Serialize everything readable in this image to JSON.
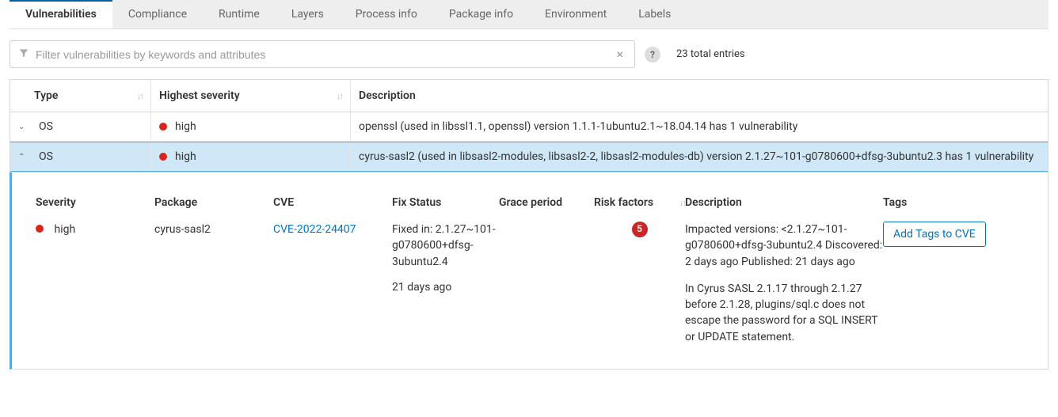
{
  "tabs": [
    {
      "label": "Vulnerabilities",
      "active": true
    },
    {
      "label": "Compliance"
    },
    {
      "label": "Runtime"
    },
    {
      "label": "Layers"
    },
    {
      "label": "Process info"
    },
    {
      "label": "Package info"
    },
    {
      "label": "Environment"
    },
    {
      "label": "Labels"
    }
  ],
  "filter": {
    "placeholder": "Filter vulnerabilities by keywords and attributes"
  },
  "total_entries": "23 total entries",
  "headers": {
    "type": "Type",
    "highest_severity": "Highest severity",
    "description": "Description"
  },
  "rows": [
    {
      "expanded": false,
      "type": "OS",
      "severity": "high",
      "description": "openssl (used in libssl1.1, openssl) version 1.1.1-1ubuntu2.1~18.04.14 has 1 vulnerability"
    },
    {
      "expanded": true,
      "type": "OS",
      "severity": "high",
      "description": "cyrus-sasl2 (used in libsasl2-modules, libsasl2-2, libsasl2-modules-db) version 2.1.27~101-g0780600+dfsg-3ubuntu2.3 has 1 vulnerability"
    }
  ],
  "detail": {
    "headers": {
      "severity": "Severity",
      "package": "Package",
      "cve": "CVE",
      "fix_status": "Fix Status",
      "grace_period": "Grace period",
      "risk_factors": "Risk factors",
      "description": "Description",
      "tags": "Tags"
    },
    "severity": "high",
    "package": "cyrus-sasl2",
    "cve": "CVE-2022-24407",
    "fix_status_line1": "Fixed in: 2.1.27~101-g0780600+dfsg-3ubuntu2.4",
    "fix_status_age": "21 days ago",
    "grace_period": "",
    "risk_factors": "5",
    "desc_block1": "Impacted versions: <2.1.27~101-g0780600+dfsg-3ubuntu2.4 Discovered: 2 days ago Published: 21 days ago",
    "desc_block2": "In Cyrus SASL 2.1.17 through 2.1.27 before 2.1.28, plugins/sql.c does not escape the password for a SQL INSERT or UPDATE statement.",
    "tags_button": "Add Tags to CVE"
  }
}
